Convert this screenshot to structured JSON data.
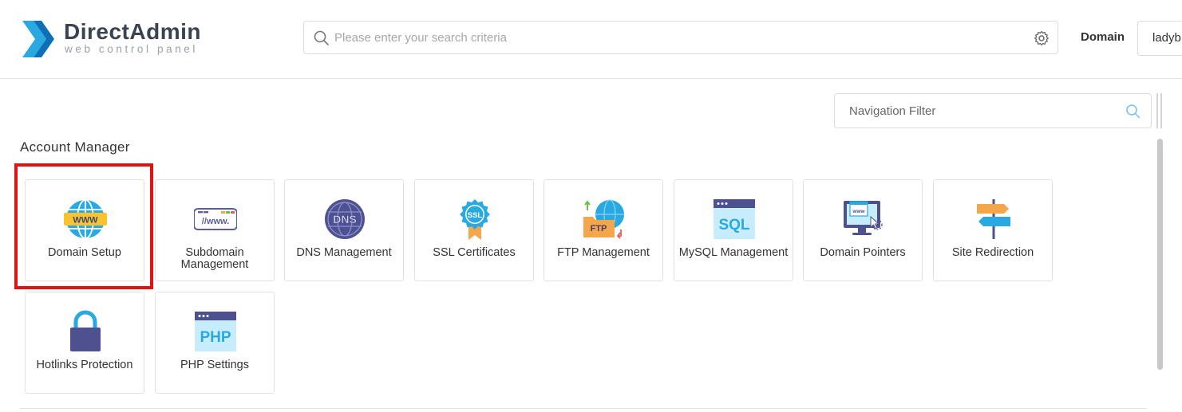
{
  "brand": {
    "title": "DirectAdmin",
    "subtitle": "web control panel"
  },
  "header": {
    "search_placeholder": "Please enter your search criteria",
    "domain_label": "Domain",
    "domain_value": "ladyb"
  },
  "nav_filter": {
    "placeholder": "Navigation Filter"
  },
  "section": {
    "title": "Account Manager",
    "items": [
      {
        "label": "Domain Setup",
        "icon": "www-globe-icon"
      },
      {
        "label": "Subdomain Management",
        "icon": "subdomain-icon"
      },
      {
        "label": "DNS Management",
        "icon": "dns-globe-icon"
      },
      {
        "label": "SSL Certificates",
        "icon": "ssl-badge-icon"
      },
      {
        "label": "FTP Management",
        "icon": "ftp-folder-icon"
      },
      {
        "label": "MySQL Management",
        "icon": "sql-window-icon"
      },
      {
        "label": "Domain Pointers",
        "icon": "monitor-pointer-icon"
      },
      {
        "label": "Site Redirection",
        "icon": "signpost-icon"
      },
      {
        "label": "Hotlinks Protection",
        "icon": "padlock-icon"
      },
      {
        "label": "PHP Settings",
        "icon": "php-window-icon"
      }
    ]
  },
  "colors": {
    "highlight": "#e01212",
    "brand_blue": "#2aa8e0",
    "text": "#333333"
  }
}
